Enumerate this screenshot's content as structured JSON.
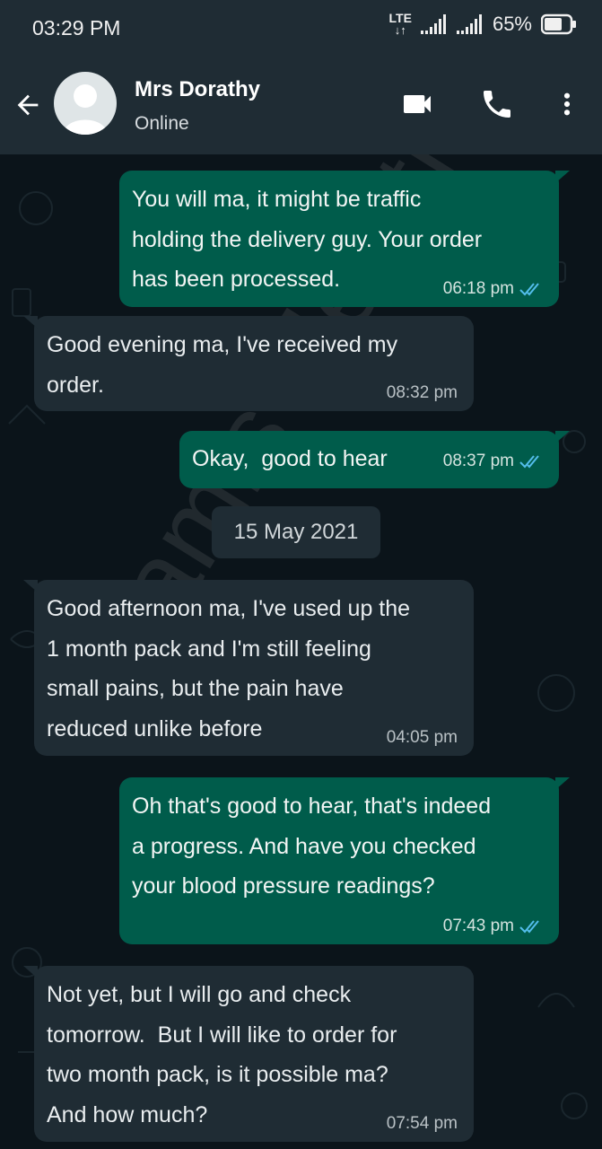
{
  "status_bar": {
    "time": "03:29 PM",
    "network": "LTE",
    "battery": "65%"
  },
  "header": {
    "contact_name": "Mrs Dorathy",
    "contact_status": "Online",
    "icons": [
      "back-arrow-icon",
      "video-call-icon",
      "phone-icon",
      "more-vert-icon"
    ]
  },
  "watermark": "Jamis Healthcare",
  "messages": [
    {
      "direction": "out",
      "text": "You will ma, it might be traffic\nholding the delivery guy. Your order\nhas been processed.",
      "time": "06:18 pm",
      "read": true
    },
    {
      "direction": "in",
      "text": "Good evening ma, I've received my\norder.",
      "time": "08:32 pm"
    },
    {
      "direction": "out",
      "text": "Okay,  good to hear",
      "time": "08:37 pm",
      "read": true
    },
    {
      "direction": "in",
      "text": "Good afternoon ma, I've used up the\n1 month pack and I'm still feeling\nsmall pains, but the pain have\nreduced unlike before",
      "time": "04:05 pm"
    },
    {
      "direction": "out",
      "text": "Oh that's good to hear, that's indeed\na progress. And have you checked\nyour blood pressure readings?",
      "time": "07:43 pm",
      "read": true
    },
    {
      "direction": "in",
      "text": "Not yet, but I will go and check\ntomorrow.  But I will like to order for\ntwo month pack, is it possible ma?\nAnd how much?",
      "time": "07:54 pm"
    }
  ],
  "date_separator": "15 May 2021",
  "colors": {
    "header_bg": "#1f2c34",
    "chat_bg": "#0b141a",
    "outgoing_bubble": "#005c4b",
    "incoming_bubble": "#1f2c34",
    "read_tick": "#53bdeb"
  }
}
